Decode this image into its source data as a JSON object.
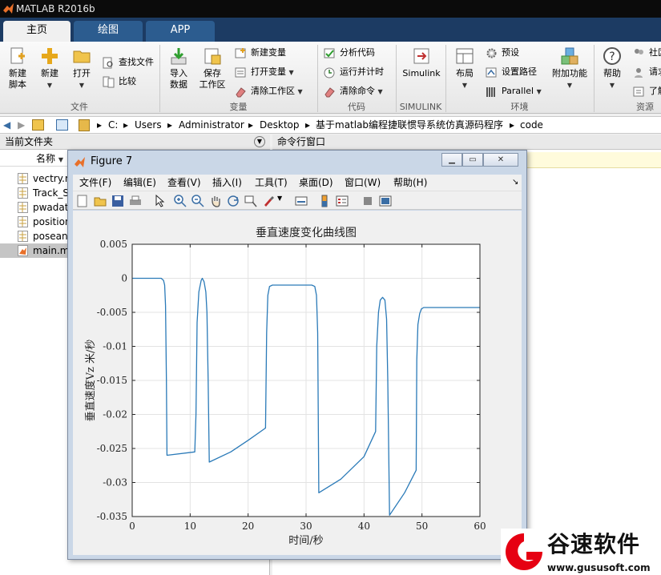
{
  "app": {
    "title": "MATLAB R2016b"
  },
  "tabs": [
    {
      "label": "主页",
      "active": true
    },
    {
      "label": "绘图",
      "active": false
    },
    {
      "label": "APP",
      "active": false
    }
  ],
  "ribbon": {
    "file": {
      "new_script": "新建\n脚本",
      "new": "新建",
      "open": "打开",
      "find_files": "查找文件",
      "compare": "比较",
      "group": "文件"
    },
    "variable": {
      "import": "导入\n数据",
      "save_ws": "保存\n工作区",
      "new_var": "新建变量",
      "open_var": "打开变量",
      "clear_ws": "清除工作区",
      "group": "变量"
    },
    "code": {
      "analyze": "分析代码",
      "run_time": "运行并计时",
      "clear_cmd": "清除命令",
      "group": "代码"
    },
    "simulink": {
      "label": "Simulink",
      "group": "SIMULINK"
    },
    "env": {
      "layout": "布局",
      "prefs": "预设",
      "set_path": "设置路径",
      "parallel": "Parallel",
      "addons": "附加功能",
      "group": "环境"
    },
    "resources": {
      "help": "帮助",
      "community": "社区",
      "request": "请求",
      "learn": "了解",
      "group": "资源"
    }
  },
  "address": {
    "segments": [
      "C:",
      "Users",
      "Administrator",
      "Desktop",
      "基于matlab编程捷联惯导系统仿真源码程序",
      "code"
    ]
  },
  "left_pane": {
    "title": "当前文件夹",
    "col_name": "名称",
    "files": [
      "vectry.m",
      "Track_S",
      "pwadat",
      "position",
      "posean",
      "main.m"
    ]
  },
  "right_pane": {
    "title": "命令行窗口"
  },
  "figure": {
    "title": "Figure 7",
    "menu": [
      "文件(F)",
      "编辑(E)",
      "查看(V)",
      "插入(I)",
      "工具(T)",
      "桌面(D)",
      "窗口(W)",
      "帮助(H)"
    ]
  },
  "chart_data": {
    "type": "line",
    "title": "垂直速度变化曲线图",
    "xlabel": "时间/秒",
    "ylabel": "垂直速度Vz 米/秒",
    "xlim": [
      0,
      60
    ],
    "ylim": [
      -0.035,
      0.005
    ],
    "xticks": [
      0,
      10,
      20,
      30,
      40,
      50,
      60
    ],
    "yticks": [
      0.005,
      0,
      -0.005,
      -0.01,
      -0.015,
      -0.02,
      -0.025,
      -0.03,
      -0.035
    ],
    "grid": true,
    "series": [
      {
        "color": "#2a7ab8",
        "x": [
          0,
          5.0,
          5.4,
          5.6,
          5.75,
          5.9,
          6.0,
          10.8,
          11.0,
          11.2,
          11.5,
          11.9,
          12.1,
          12.4,
          12.7,
          12.9,
          13.1,
          13.3,
          17.0,
          20.0,
          23.0,
          23.2,
          23.4,
          23.7,
          24.2,
          31.0,
          31.5,
          31.8,
          32.0,
          32.2,
          36.0,
          40.0,
          42.0,
          42.2,
          42.5,
          42.8,
          43.2,
          43.6,
          43.9,
          44.1,
          44.4,
          47.0,
          49.0,
          49.1,
          49.3,
          49.6,
          49.9,
          50.3,
          60.0
        ],
        "y": [
          0,
          0,
          -0.0003,
          -0.001,
          -0.004,
          -0.015,
          -0.026,
          -0.0255,
          -0.02,
          -0.0065,
          -0.002,
          -0.0003,
          0,
          -0.0005,
          -0.002,
          -0.005,
          -0.015,
          -0.027,
          -0.0255,
          -0.0238,
          -0.022,
          -0.008,
          -0.0025,
          -0.0012,
          -0.001,
          -0.001,
          -0.0012,
          -0.0025,
          -0.008,
          -0.0315,
          -0.0295,
          -0.0262,
          -0.0225,
          -0.01,
          -0.005,
          -0.0032,
          -0.0028,
          -0.0032,
          -0.006,
          -0.015,
          -0.0348,
          -0.0315,
          -0.0282,
          -0.012,
          -0.0068,
          -0.0052,
          -0.0045,
          -0.0043,
          -0.0043
        ]
      }
    ]
  },
  "watermark": {
    "name": "谷速软件",
    "url": "www.gususoft.com"
  },
  "colors": {
    "tabstrip": "#1c3b63",
    "accent_line": "#2a7ab8",
    "watermark_red": "#e60012"
  }
}
